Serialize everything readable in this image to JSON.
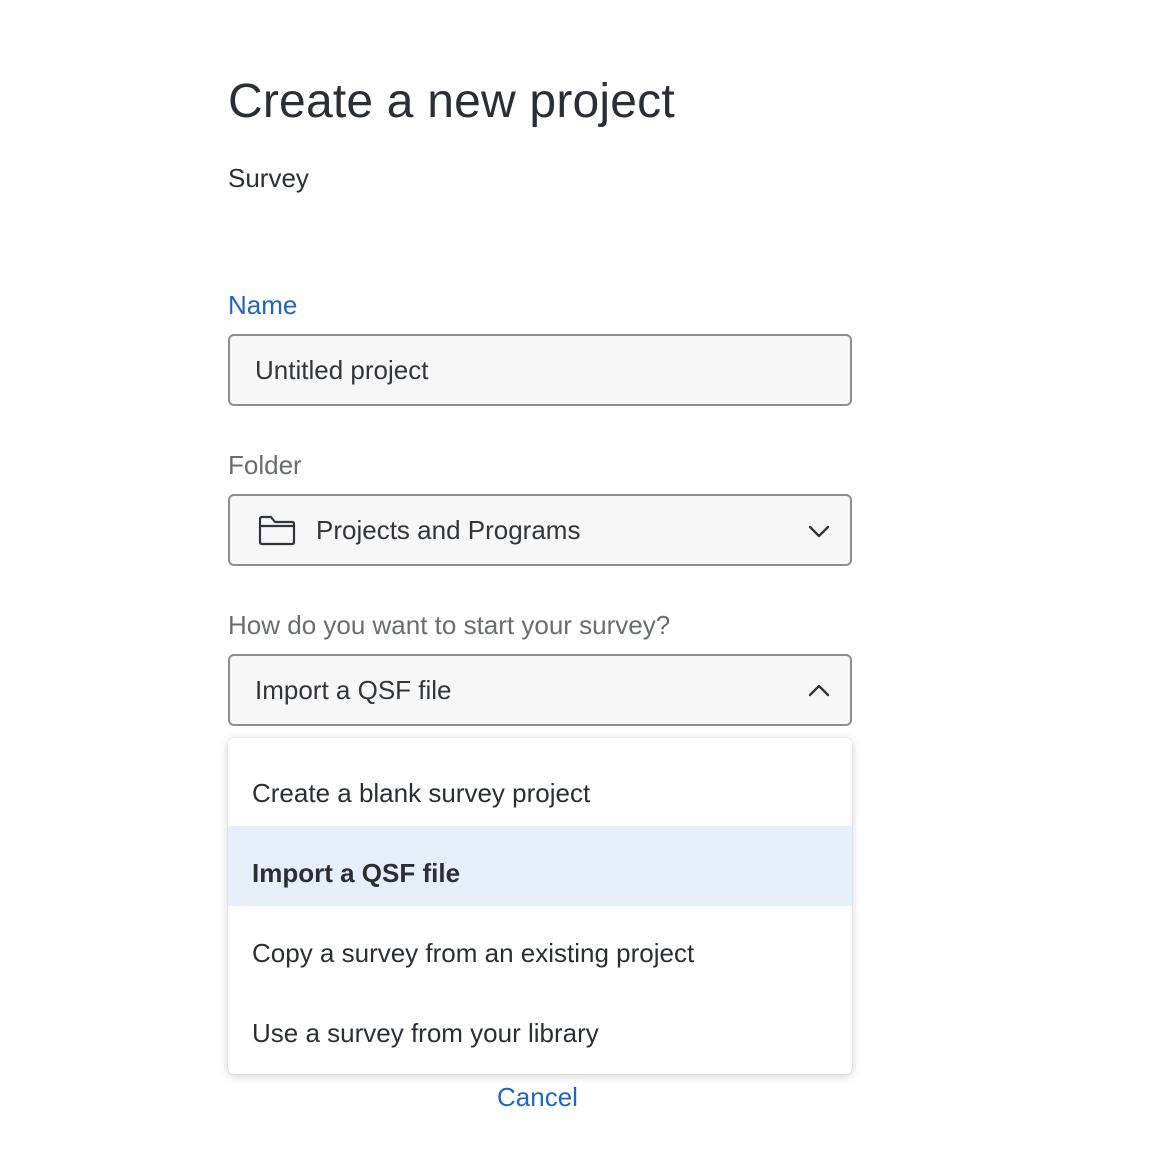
{
  "header": {
    "title": "Create a new project",
    "subtitle": "Survey"
  },
  "form": {
    "name": {
      "label": "Name",
      "value": "Untitled project"
    },
    "folder": {
      "label": "Folder",
      "value": "Projects and Programs",
      "icon": "folder-icon",
      "chevron": "chevron-down-icon"
    },
    "start_method": {
      "label": "How do you want to start your survey?",
      "value": "Import a QSF file",
      "chevron": "chevron-up-icon",
      "expanded": true,
      "options": [
        {
          "label": "Create a blank survey project",
          "selected": false
        },
        {
          "label": "Import a QSF file",
          "selected": true
        },
        {
          "label": "Copy a survey from an existing project",
          "selected": false
        },
        {
          "label": "Use a survey from your library",
          "selected": false
        }
      ]
    }
  },
  "footer": {
    "cancel_label": "Cancel"
  },
  "colors": {
    "accent": "#1f66c1",
    "selected_option_bg": "#e6eef9",
    "field_bg": "#f7f7f7",
    "field_border": "#8c8f92"
  }
}
